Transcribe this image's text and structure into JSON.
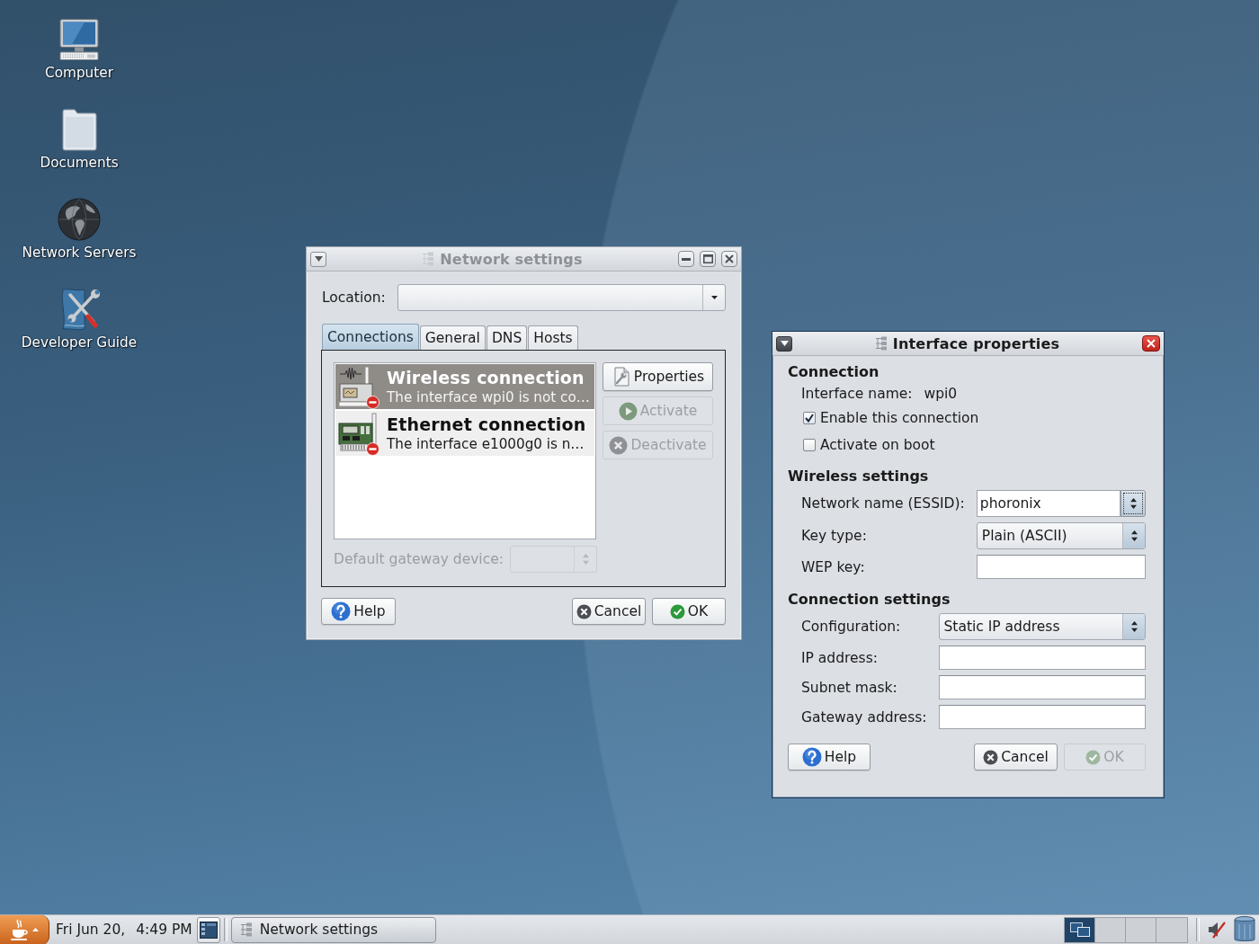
{
  "desktop_icons": [
    {
      "label": "Computer",
      "kind": "computer"
    },
    {
      "label": "Documents",
      "kind": "folder"
    },
    {
      "label": "Network Servers",
      "kind": "network"
    },
    {
      "label": "Developer Guide",
      "kind": "guide"
    }
  ],
  "network_settings": {
    "title": "Network settings",
    "active": false,
    "title_buttons": [
      {
        "kind": "minimize"
      },
      {
        "kind": "maximize"
      },
      {
        "kind": "close"
      }
    ],
    "location": {
      "label": "Location:"
    },
    "tabs": [
      {
        "label": "Connections",
        "selected": true
      },
      {
        "label": "General",
        "selected": false
      },
      {
        "label": "DNS",
        "selected": false
      },
      {
        "label": "Hosts",
        "selected": false
      }
    ],
    "connections": [
      {
        "kind": "wireless",
        "name": "Wireless connection",
        "description": "The interface wpi0 is not co…",
        "selected": true,
        "connected": false
      },
      {
        "kind": "ethernet",
        "name": "Ethernet connection",
        "description": "The interface e1000g0 is n…",
        "selected": false,
        "connected": false
      }
    ],
    "actions": [
      {
        "kind": "properties",
        "label": "Properties",
        "disabled": false
      },
      {
        "kind": "activate",
        "label": "Activate",
        "disabled": true
      },
      {
        "kind": "deactivate",
        "label": "Deactivate",
        "disabled": true
      }
    ],
    "gateway_device": {
      "label": "Default gateway device:",
      "disabled": true
    },
    "buttons": [
      {
        "kind": "help",
        "label": "Help",
        "disabled": false
      },
      {
        "kind": "cancel",
        "label": "Cancel",
        "disabled": false
      },
      {
        "kind": "ok",
        "label": "OK",
        "disabled": false
      }
    ]
  },
  "interface_properties": {
    "title": "Interface properties",
    "active": true,
    "title_buttons": [
      {
        "kind": "close"
      }
    ],
    "sections": [
      {
        "heading": "Connection",
        "rows": [
          {
            "kind": "info",
            "label": "Interface name:",
            "value": "wpi0"
          },
          {
            "kind": "checkbox",
            "label": "Enable this connection",
            "checked": true
          },
          {
            "kind": "checkbox",
            "label": "Activate on boot",
            "checked": false
          }
        ]
      },
      {
        "heading": "Wireless settings",
        "rows": [
          {
            "kind": "combo-entry",
            "label": "Network name (ESSID):",
            "value": "phoronix"
          },
          {
            "kind": "select",
            "label": "Key type:",
            "value": "Plain (ASCII)"
          },
          {
            "kind": "entry",
            "label": "WEP key:"
          }
        ]
      },
      {
        "heading": "Connection settings",
        "rows": [
          {
            "kind": "select",
            "label": "Configuration:",
            "value": "Static IP address"
          },
          {
            "kind": "entry",
            "label": "IP address:"
          },
          {
            "kind": "entry",
            "label": "Subnet mask:"
          },
          {
            "kind": "entry",
            "label": "Gateway address:"
          }
        ]
      }
    ],
    "buttons": [
      {
        "kind": "help",
        "label": "Help",
        "disabled": false
      },
      {
        "kind": "cancel",
        "label": "Cancel",
        "disabled": false
      },
      {
        "kind": "ok",
        "label": "OK",
        "disabled": true
      }
    ]
  },
  "taskbar": {
    "date": "Fri Jun 20,",
    "time": "4:49 PM",
    "tasks": [
      {
        "label": "Network settings"
      }
    ],
    "workspaces": [
      {
        "selected": true
      },
      {
        "selected": false
      },
      {
        "selected": false
      },
      {
        "selected": false
      }
    ],
    "volume": {
      "muted": true
    }
  }
}
